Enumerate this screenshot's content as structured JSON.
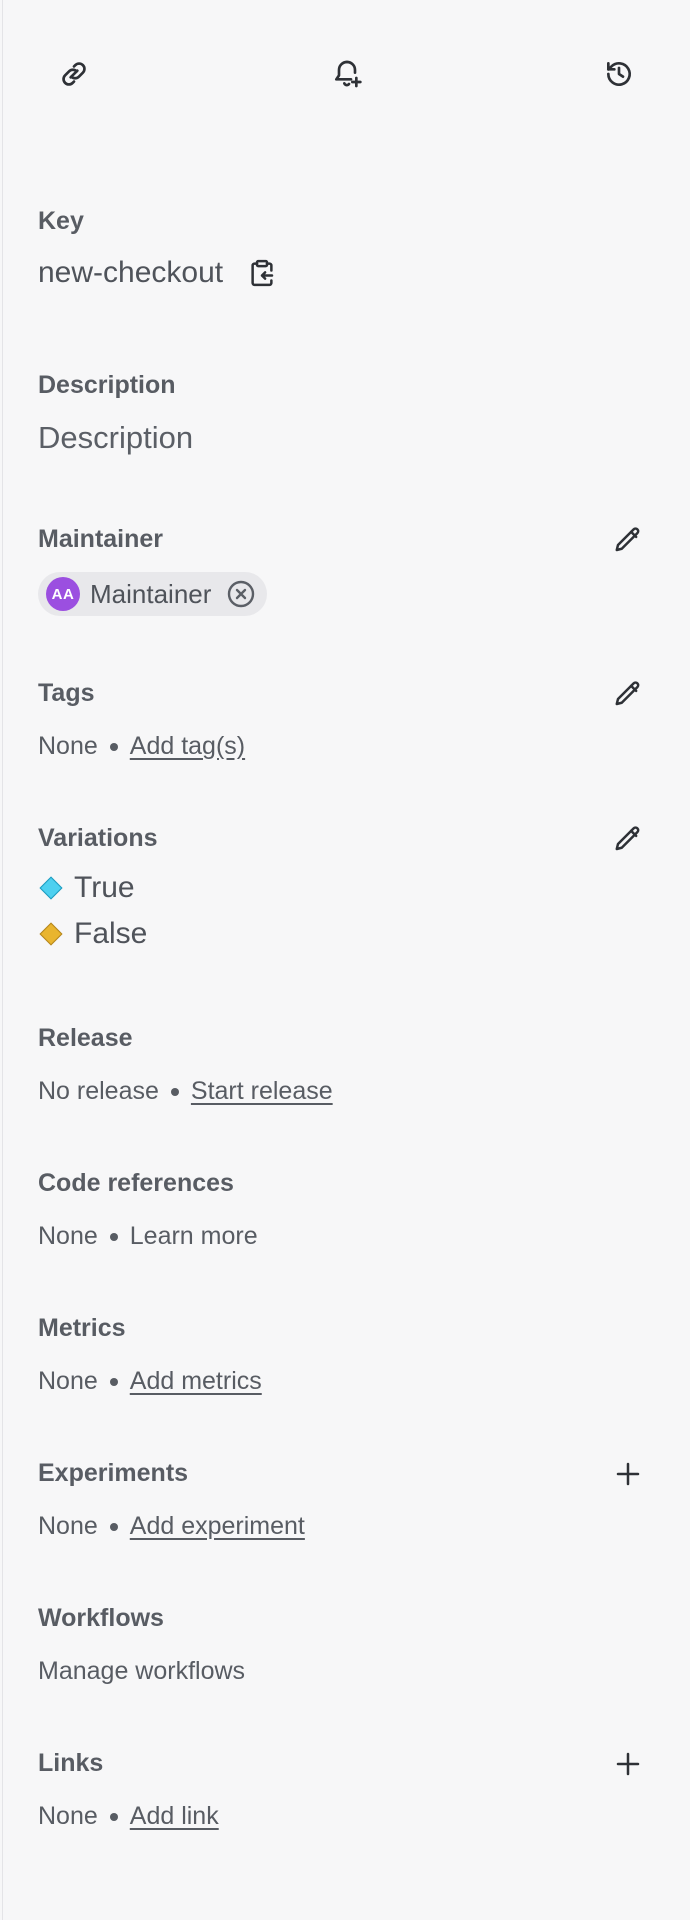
{
  "toolbar": {
    "copy_link_icon": "link-icon",
    "notify_icon": "bell-plus-icon",
    "history_icon": "history-icon"
  },
  "key": {
    "label": "Key",
    "value": "new-checkout",
    "copy_icon": "clipboard-copy-icon"
  },
  "description": {
    "label": "Description",
    "placeholder": "Description"
  },
  "maintainer": {
    "label": "Maintainer",
    "initials": "AA",
    "name": "Maintainer",
    "avatar_color": "#9b4fe0"
  },
  "tags": {
    "label": "Tags",
    "value": "None",
    "action": "Add tag(s)"
  },
  "variations": {
    "label": "Variations",
    "items": [
      {
        "name": "True",
        "color": "#4dd0f0"
      },
      {
        "name": "False",
        "color": "#e9b52f"
      }
    ]
  },
  "release": {
    "label": "Release",
    "value": "No release",
    "action": "Start release"
  },
  "code_references": {
    "label": "Code references",
    "value": "None",
    "action": "Learn more"
  },
  "metrics": {
    "label": "Metrics",
    "value": "None",
    "action": "Add metrics"
  },
  "experiments": {
    "label": "Experiments",
    "value": "None",
    "action": "Add experiment"
  },
  "workflows": {
    "label": "Workflows",
    "action": "Manage workflows"
  },
  "links": {
    "label": "Links",
    "value": "None",
    "action": "Add link"
  }
}
